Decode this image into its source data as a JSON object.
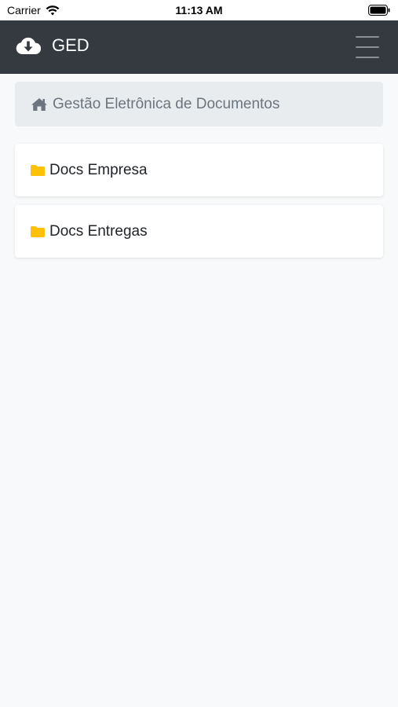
{
  "status_bar": {
    "carrier": "Carrier",
    "time": "11:13 AM",
    "wifi_icon": "wifi-icon",
    "battery_icon": "battery-icon"
  },
  "navbar": {
    "brand_icon": "cloud-download-icon",
    "brand_label": "GED",
    "menu_icon": "hamburger-menu-icon",
    "background": "#343a40"
  },
  "breadcrumb": {
    "icon": "home-icon",
    "label": "Gestão Eletrônica de Documentos"
  },
  "folders": [
    {
      "icon": "folder-icon",
      "label": "Docs Empresa",
      "color": "#ffc107"
    },
    {
      "icon": "folder-icon",
      "label": "Docs Entregas",
      "color": "#ffc107"
    }
  ]
}
